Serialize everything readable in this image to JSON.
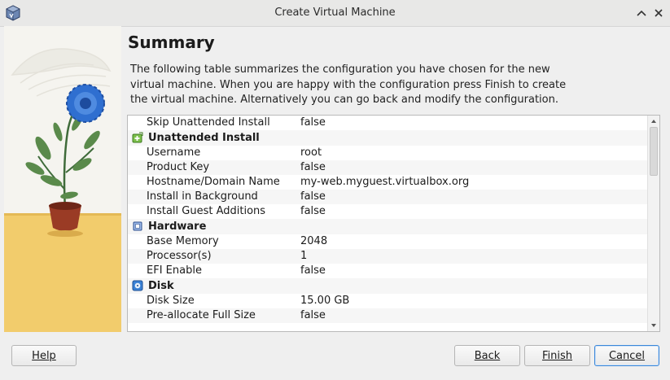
{
  "window": {
    "title": "Create Virtual Machine"
  },
  "page": {
    "heading": "Summary",
    "description": "The following table summarizes the configuration you have chosen for the new virtual machine. When you are happy with the configuration press Finish to create the virtual machine. Alternatively you can go back and modify the configuration."
  },
  "table": {
    "top_row": {
      "key": "Skip Unattended Install",
      "value": "false"
    },
    "sections": [
      {
        "title": "Unattended Install",
        "icon": "unattended-install-icon",
        "rows": [
          {
            "key": "Username",
            "value": "root"
          },
          {
            "key": "Product Key",
            "value": "false"
          },
          {
            "key": "Hostname/Domain Name",
            "value": "my-web.myguest.virtualbox.org"
          },
          {
            "key": "Install in Background",
            "value": "false"
          },
          {
            "key": "Install Guest Additions",
            "value": "false"
          }
        ]
      },
      {
        "title": "Hardware",
        "icon": "hardware-chip-icon",
        "rows": [
          {
            "key": "Base Memory",
            "value": "2048"
          },
          {
            "key": "Processor(s)",
            "value": "1"
          },
          {
            "key": "EFI Enable",
            "value": "false"
          }
        ]
      },
      {
        "title": "Disk",
        "icon": "hard-disk-icon",
        "rows": [
          {
            "key": "Disk Size",
            "value": "15.00 GB"
          },
          {
            "key": "Pre-allocate Full Size",
            "value": "false"
          }
        ]
      }
    ]
  },
  "buttons": {
    "help": "Help",
    "back": "Back",
    "finish": "Finish",
    "cancel": "Cancel"
  },
  "colors": {
    "accent": "#3a87d9",
    "flower": "#2f6fd0",
    "table_alt_row": "#f6f6f6"
  }
}
